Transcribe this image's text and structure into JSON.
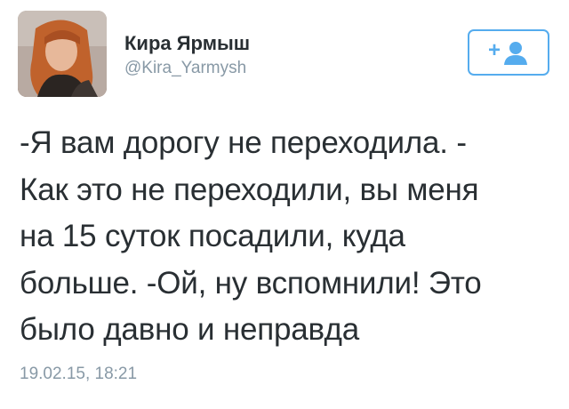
{
  "author": {
    "display_name": "Кира Ярмыш",
    "screen_name": "@Kira_Yarmysh"
  },
  "follow_button": {
    "plus_glyph": "+",
    "icon": "follow-person-icon",
    "accent_color": "#55acee"
  },
  "tweet": {
    "lines": [
      "-Я вам дорогу не переходила. -",
      "Как это не переходили, вы меня",
      "на 15 суток посадили, куда",
      "больше. -Ой, ну вспомнили! Это",
      "было давно и неправда"
    ],
    "timestamp": "19.02.15, 18:21"
  },
  "colors": {
    "text": "#292f33",
    "secondary": "#8899a6"
  }
}
